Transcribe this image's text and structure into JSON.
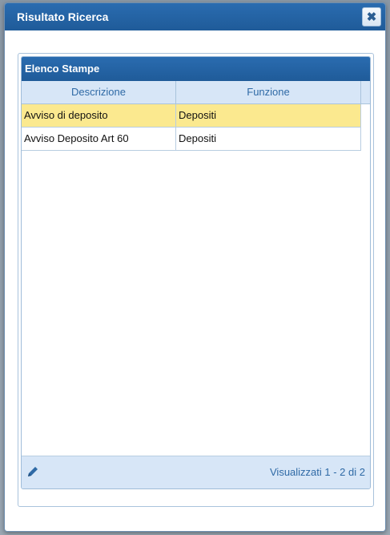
{
  "dialog": {
    "title": "Risultato Ricerca",
    "close_icon": "close-icon"
  },
  "grid": {
    "caption": "Elenco Stampe",
    "columns": [
      "Descrizione",
      "Funzione"
    ],
    "rows": [
      {
        "descrizione": "Avviso di deposito",
        "funzione": "Depositi",
        "selected": true
      },
      {
        "descrizione": "Avviso Deposito Art 60",
        "funzione": "Depositi",
        "selected": false
      }
    ],
    "footer": {
      "edit_icon": "pencil-icon",
      "pager_info": "Visualizzati 1 - 2 di 2"
    }
  },
  "colors": {
    "header_blue": "#2a6cb0",
    "selected_row": "#fbe98f",
    "grid_header_bg": "#d7e6f7"
  }
}
